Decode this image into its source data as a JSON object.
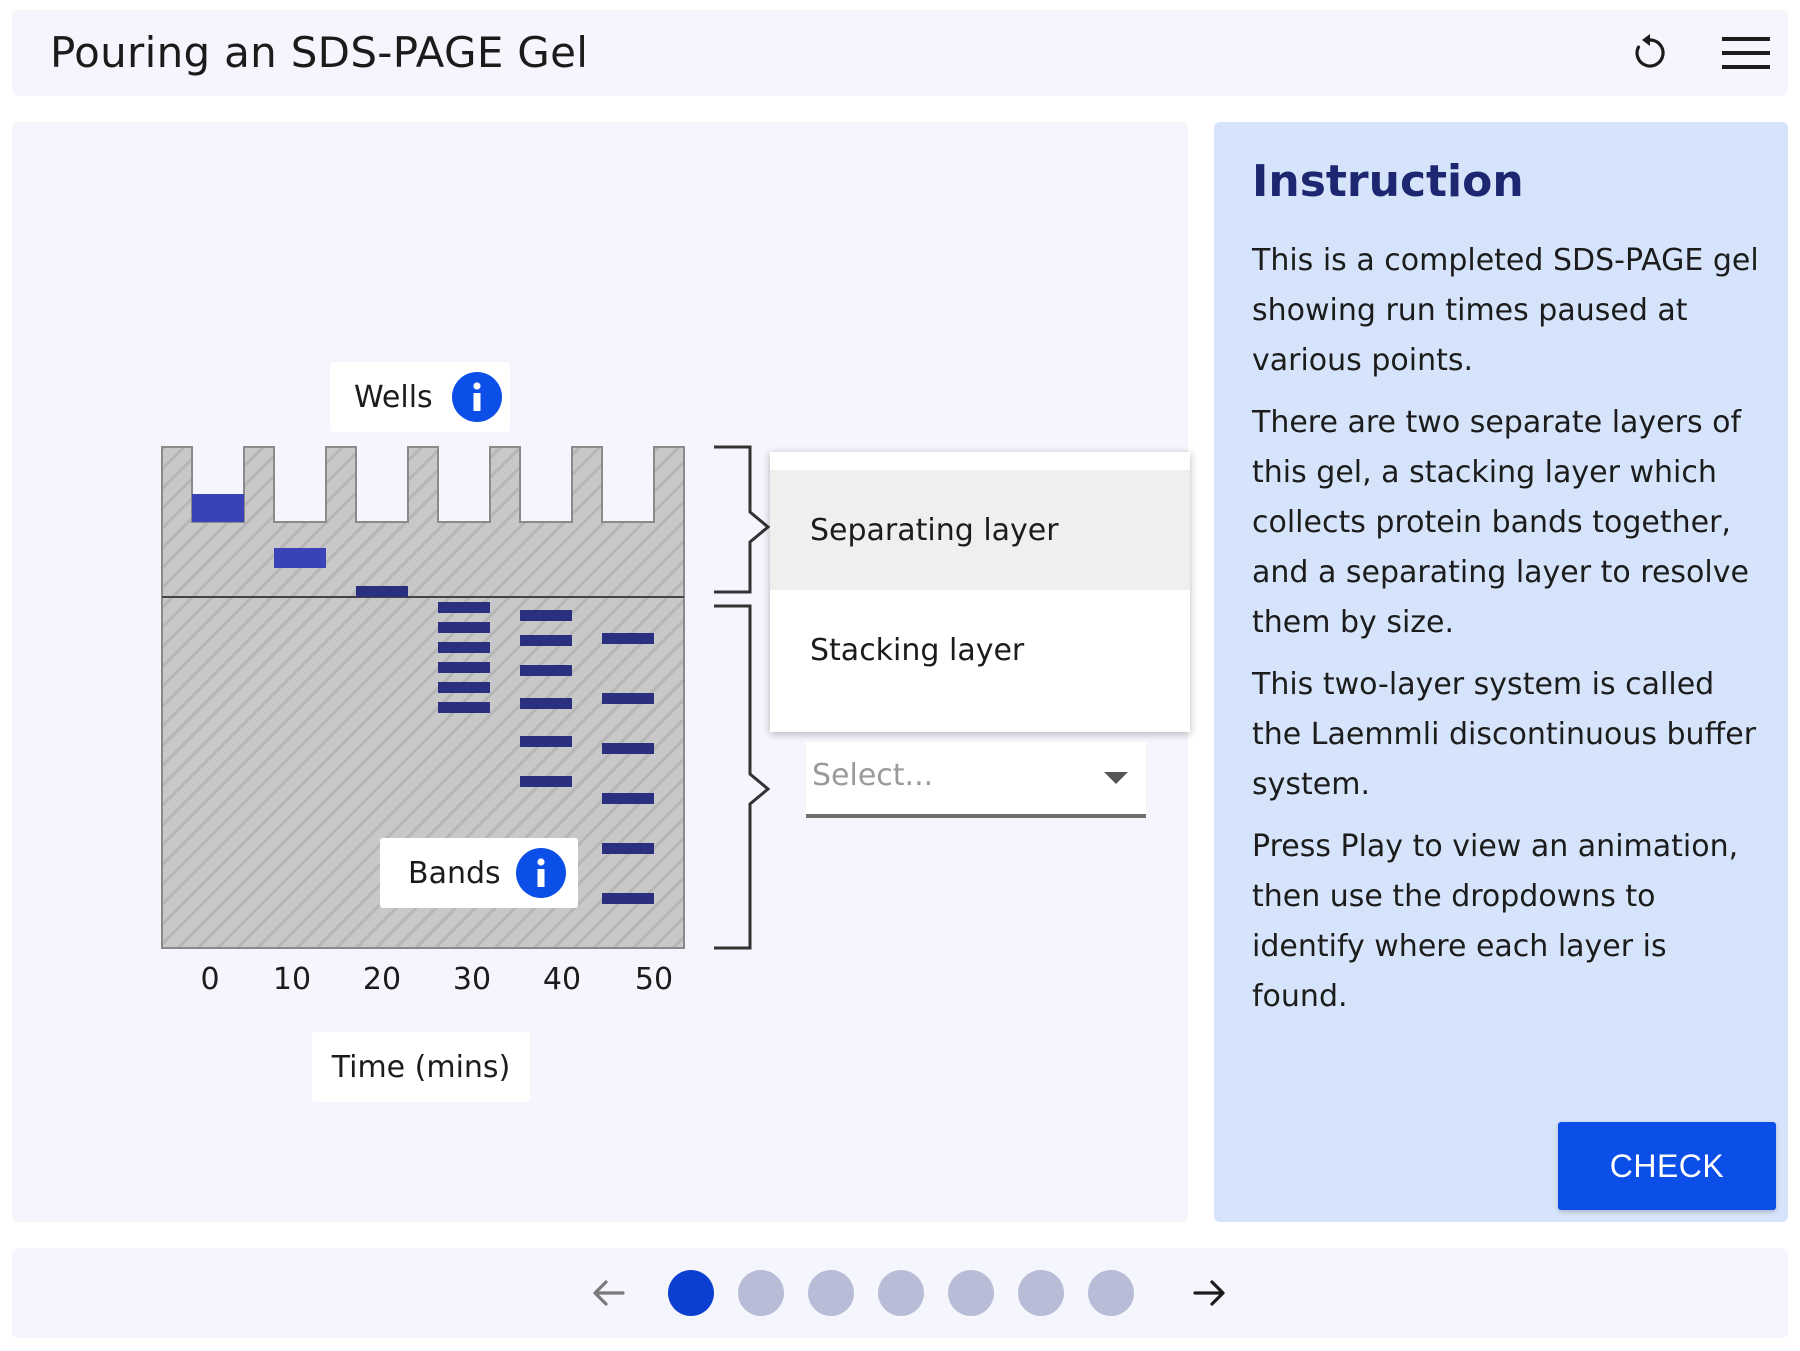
{
  "header": {
    "title": "Pouring an SDS-PAGE Gel",
    "icons": [
      "reset-icon",
      "menu-icon"
    ]
  },
  "diagram": {
    "wells_label": "Wells",
    "bands_label": "Bands",
    "time_label": "Time (mins)",
    "time_ticks": [
      "0",
      "10",
      "20",
      "30",
      "40",
      "50"
    ]
  },
  "dropdown": {
    "options": [
      "Separating layer",
      "Stacking layer"
    ],
    "highlighted": "Separating layer",
    "placeholder": "Select..."
  },
  "instruction": {
    "title": "Instruction",
    "paragraphs": [
      "This is a completed SDS-PAGE gel showing run times paused at various points.",
      "There are two separate layers of this gel, a stacking layer which collects protein bands together, and a separating layer to resolve them by size.",
      "This two-layer system is called the Laemmli discontinuous buffer system.",
      "Press Play to view an animation, then use the dropdowns to identify where each layer is found."
    ],
    "check_label": "CHECK"
  },
  "pagination": {
    "total": 7,
    "current": 1
  },
  "colors": {
    "accent": "#0b4fe8",
    "band_dark": "#2a2f7f",
    "band_light": "#3a42b8",
    "gel": "#c6c6c6"
  }
}
